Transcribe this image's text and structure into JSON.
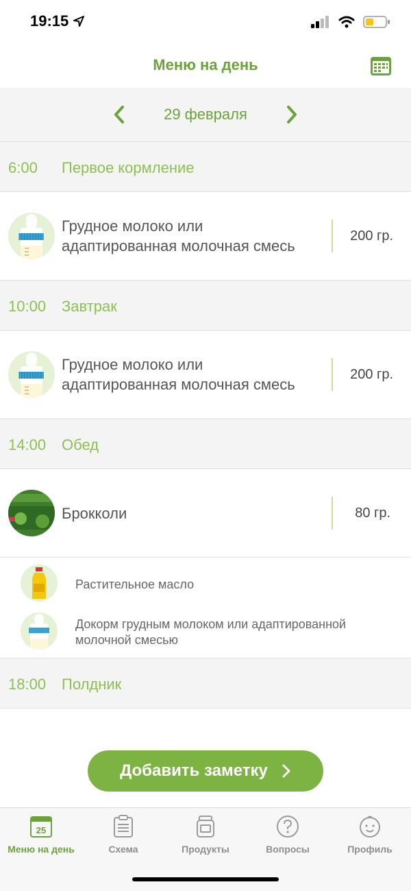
{
  "status": {
    "time": "19:15"
  },
  "header": {
    "title": "Меню на день"
  },
  "date_nav": {
    "date": "29 февраля"
  },
  "meals": [
    {
      "time": "6:00",
      "name": "Первое кормление",
      "food": {
        "name_line1": "Грудное молоко или",
        "name_line2": "адаптированная молочная смесь",
        "amount": "200 гр.",
        "icon": "baby-bottle-icon"
      }
    },
    {
      "time": "10:00",
      "name": "Завтрак",
      "food": {
        "name_line1": "Грудное молоко или",
        "name_line2": "адаптированная молочная смесь",
        "amount": "200 гр.",
        "icon": "baby-bottle-icon"
      }
    },
    {
      "time": "14:00",
      "name": "Обед",
      "food": {
        "name": "Брокколи",
        "amount": "80 гр.",
        "icon": "broccoli-jar-icon"
      },
      "addons": [
        {
          "name": "Растительное масло",
          "icon": "oil-bottle-icon"
        },
        {
          "name_line1": "Докорм грудным молоком или адаптированной",
          "name_line2": "молочной смесью",
          "icon": "baby-bottle-icon"
        }
      ]
    },
    {
      "time": "18:00",
      "name": "Полдник"
    }
  ],
  "add_note": {
    "label": "Добавить заметку"
  },
  "tabs": [
    {
      "label": "Меню на день",
      "icon": "calendar-day-icon",
      "badge": "25",
      "active": true
    },
    {
      "label": "Схема",
      "icon": "clipboard-icon"
    },
    {
      "label": "Продукты",
      "icon": "jar-icon"
    },
    {
      "label": "Вопросы",
      "icon": "question-icon"
    },
    {
      "label": "Профиль",
      "icon": "baby-face-icon"
    }
  ],
  "colors": {
    "accent": "#6aa33a",
    "accent_light": "#8cc152",
    "button": "#7cb342",
    "section_bg": "#f4f4f4"
  }
}
